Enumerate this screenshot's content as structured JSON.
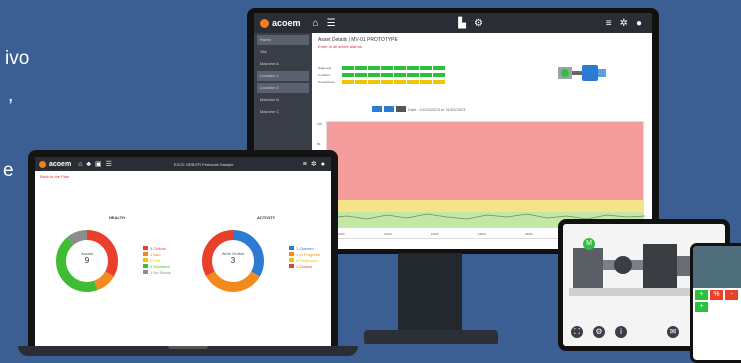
{
  "side_text": [
    "ivo",
    ",",
    "e"
  ],
  "monitor": {
    "brand": "acoem",
    "sidebar": [
      "Home",
      "Site",
      "Machine A",
      "Location 1",
      "Location 2",
      "Machine B",
      "Machine C"
    ],
    "title": "Asset Details | MV-01 PROTOTYPE",
    "subtitle": "Enter to all active alarms",
    "status_rows": [
      "Diagnosis",
      "Condition",
      "Overall level"
    ],
    "filter_text": "Date : 01/03/2023 to 31/03/2023",
    "plot_y_ticks": [
      "100",
      "80",
      "60",
      "40",
      "20",
      "0"
    ],
    "plot_x_ticks": [
      "10/03",
      "13/03",
      "16/03",
      "19/03",
      "22/03",
      "25/03",
      "28/03"
    ]
  },
  "laptop": {
    "brand": "acoem",
    "window_title": "EXCE ORBITR Protocols Sample",
    "back_link": "Back to the Plan",
    "health": {
      "title": "HEALTH",
      "center_label": "Assets",
      "center_value": "9",
      "legend": [
        {
          "label": "3 Critical",
          "color": "#e8402a"
        },
        {
          "label": "1 Bad",
          "color": "#f28a1e"
        },
        {
          "label": "0 Fair",
          "color": "#f2c400"
        },
        {
          "label": "4 Excellent",
          "color": "#3fbb34"
        },
        {
          "label": "1 No Status",
          "color": "#8c8c8c"
        }
      ],
      "segments": [
        {
          "value": 3,
          "color": "#e8402a"
        },
        {
          "value": 1,
          "color": "#f28a1e"
        },
        {
          "value": 4,
          "color": "#3fbb34"
        },
        {
          "value": 1,
          "color": "#8c8c8c"
        }
      ]
    },
    "activity": {
      "title": "ACTIVITY",
      "center_label": "Work Orders",
      "center_value": "3",
      "legend": [
        {
          "label": "1 Opened",
          "color": "#2b7bd3"
        },
        {
          "label": "1 In Progress",
          "color": "#f28a1e"
        },
        {
          "label": "0 Postponed",
          "color": "#f2c400"
        },
        {
          "label": "1 Closed",
          "color": "#e8402a"
        }
      ],
      "segments": [
        {
          "value": 1,
          "color": "#2b7bd3"
        },
        {
          "value": 1,
          "color": "#f28a1e"
        },
        {
          "value": 1,
          "color": "#e8402a"
        }
      ]
    }
  },
  "tablet": {
    "badge": "M"
  },
  "phone": {
    "tiles": [
      "+",
      "%",
      "-",
      "+"
    ]
  },
  "colors": {
    "background": "#3b5f93",
    "accent": "#ef7d22",
    "chart_red": "#f59c9c",
    "chart_yellow": "#f3e38a",
    "chart_green": "#c3e7a6"
  }
}
